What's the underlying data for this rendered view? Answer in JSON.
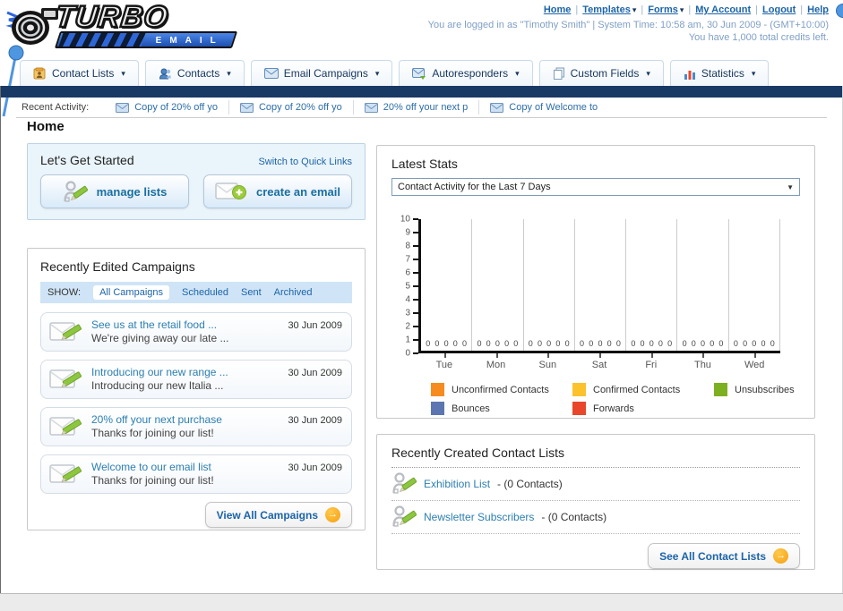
{
  "brand": {
    "name_top": "TURBO",
    "name_bottom": "EMAIL",
    "icon": "turbocharger-logo-icon"
  },
  "colors": {
    "navy_bar": "#1a3a66",
    "link_blue": "#1c64a8",
    "status_text": "#7f9fc6",
    "accent_orange": "#f59f0f",
    "panel_blue_bg": "#eaf4fb",
    "filter_bar_bg": "#cfe4f6"
  },
  "header": {
    "links": [
      {
        "label": "Home",
        "dropdown": false
      },
      {
        "label": "Templates",
        "dropdown": true
      },
      {
        "label": "Forms",
        "dropdown": true
      },
      {
        "label": "My Account",
        "dropdown": false
      },
      {
        "label": "Logout",
        "dropdown": false
      },
      {
        "label": "Help",
        "dropdown": false
      }
    ],
    "status_line1": "You are logged in as \"Timothy Smith\" | System Time: 10:58 am, 30 Jun 2009 - (GMT+10:00)",
    "status_line2": "You have 1,000 total credits left."
  },
  "nav": {
    "tabs": [
      {
        "label": "Contact Lists",
        "icon": "contact-lists-icon"
      },
      {
        "label": "Contacts",
        "icon": "contacts-icon"
      },
      {
        "label": "Email Campaigns",
        "icon": "email-campaigns-icon"
      },
      {
        "label": "Autoresponders",
        "icon": "autoresponders-icon"
      },
      {
        "label": "Custom Fields",
        "icon": "custom-fields-icon"
      },
      {
        "label": "Statistics",
        "icon": "statistics-icon"
      }
    ]
  },
  "recent_activity": {
    "label": "Recent Activity:",
    "items": [
      {
        "label": "Copy of 20% off yo",
        "icon": "envelope-icon"
      },
      {
        "label": "Copy of 20% off yo",
        "icon": "envelope-icon"
      },
      {
        "label": "20% off your next p",
        "icon": "envelope-icon"
      },
      {
        "label": "Copy of Welcome to",
        "icon": "envelope-icon"
      }
    ]
  },
  "page_title": "Home",
  "get_started": {
    "title": "Let's Get Started",
    "switch_link": "Switch to Quick Links",
    "buttons": [
      {
        "label": "manage lists",
        "icon": "person-pencil-icon"
      },
      {
        "label": "create an email",
        "icon": "envelope-plus-icon"
      }
    ]
  },
  "campaigns": {
    "title": "Recently Edited Campaigns",
    "show_label": "SHOW:",
    "filters": [
      "All Campaigns",
      "Scheduled",
      "Sent",
      "Archived"
    ],
    "active_filter": "All Campaigns",
    "items": [
      {
        "title": "See us at the retail food ...",
        "subtitle": "We're giving away our late ...",
        "date": "30 Jun 2009",
        "icon": "envelope-pencil-icon"
      },
      {
        "title": "Introducing our new range ...",
        "subtitle": "Introducing our new Italia ...",
        "date": "30 Jun 2009",
        "icon": "envelope-pencil-icon"
      },
      {
        "title": "20% off your next purchase",
        "subtitle": "Thanks for joining our list!",
        "date": "30 Jun 2009",
        "icon": "envelope-pencil-icon"
      },
      {
        "title": "Welcome to our email list",
        "subtitle": "Thanks for joining our list!",
        "date": "30 Jun 2009",
        "icon": "envelope-pencil-icon"
      }
    ],
    "view_all_label": "View All Campaigns"
  },
  "stats": {
    "title": "Latest Stats",
    "dropdown_value": "Contact Activity for the Last 7 Days"
  },
  "chart_data": {
    "type": "bar",
    "title": "Contact Activity for the Last 7 Days",
    "categories": [
      "Tue",
      "Mon",
      "Sun",
      "Sat",
      "Fri",
      "Thu",
      "Wed"
    ],
    "series": [
      {
        "name": "Unconfirmed Contacts",
        "color": "#F68B1F",
        "values": [
          0,
          0,
          0,
          0,
          0,
          0,
          0
        ]
      },
      {
        "name": "Confirmed Contacts",
        "color": "#FBC22D",
        "values": [
          0,
          0,
          0,
          0,
          0,
          0,
          0
        ]
      },
      {
        "name": "Unsubscribes",
        "color": "#7CB021",
        "values": [
          0,
          0,
          0,
          0,
          0,
          0,
          0
        ]
      },
      {
        "name": "Bounces",
        "color": "#5B76B0",
        "values": [
          0,
          0,
          0,
          0,
          0,
          0,
          0
        ]
      },
      {
        "name": "Forwards",
        "color": "#E8472B",
        "values": [
          0,
          0,
          0,
          0,
          0,
          0,
          0
        ]
      }
    ],
    "ylim": [
      0,
      10
    ],
    "yticks": [
      0,
      1,
      2,
      3,
      4,
      5,
      6,
      7,
      8,
      9,
      10
    ],
    "xlabel": "",
    "ylabel": "",
    "grid": "vertical-day-separators",
    "legend_position": "bottom",
    "data_labels_shown_per_group": "0 0 0 0 0"
  },
  "contact_lists": {
    "title": "Recently Created Contact Lists",
    "items": [
      {
        "name": "Exhibition List",
        "count_text": "- (0 Contacts)",
        "icon": "person-pencil-icon"
      },
      {
        "name": "Newsletter Subscribers",
        "count_text": "- (0 Contacts)",
        "icon": "person-pencil-icon"
      }
    ],
    "see_all_label": "See All Contact Lists"
  }
}
